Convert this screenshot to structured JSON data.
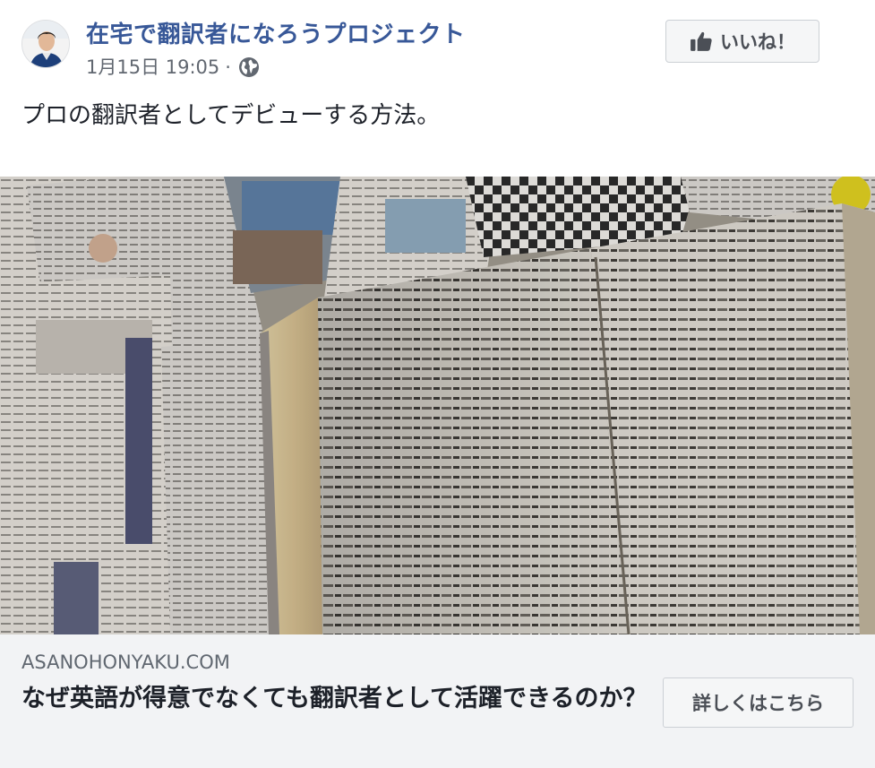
{
  "post": {
    "page_name": "在宅で翻訳者になろうプロジェクト",
    "timestamp": "1月15日 19:05",
    "separator": "·",
    "privacy_icon": "globe-icon",
    "like_button_label": "いいね！",
    "like_icon": "thumbs-up-icon",
    "text": "プロの翻訳者としてデビューする方法。"
  },
  "link_preview": {
    "domain": "ASANOHONYAKU.COM",
    "title": "なぜ英語が得意でなくても翻訳者として活躍できるのか？",
    "cta_label": "詳しくはこちら"
  },
  "colors": {
    "page_name": "#385898",
    "meta_text": "#616770",
    "body_text": "#1d2129",
    "link_box_bg": "#f2f3f5",
    "button_bg": "#f5f6f7",
    "button_border": "#ccd0d5"
  }
}
